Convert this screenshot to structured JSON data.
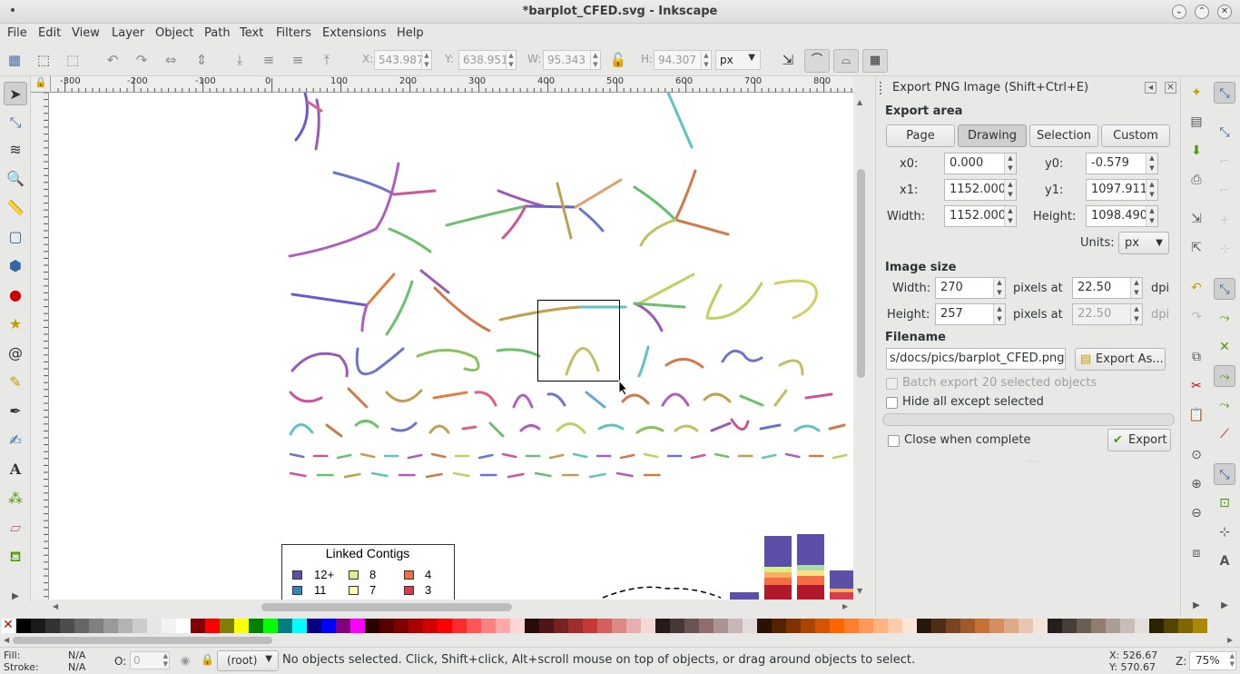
{
  "window": {
    "title": "*barplot_CFED.svg - Inkscape"
  },
  "menu": [
    "File",
    "Edit",
    "View",
    "Layer",
    "Object",
    "Path",
    "Text",
    "Filters",
    "Extensions",
    "Help"
  ],
  "toolbar": {
    "x_label": "X:",
    "x_value": "543.987",
    "y_label": "Y:",
    "y_value": "638.951",
    "w_label": "W:",
    "w_value": "95.343",
    "h_label": "H:",
    "h_value": "94.307",
    "unit": "px"
  },
  "ruler": {
    "h_ticks": [
      "-300",
      "-200",
      "-100",
      "0",
      "100",
      "200",
      "300",
      "400",
      "500",
      "600",
      "700",
      "800"
    ]
  },
  "canvas": {
    "legend_title": "Linked Contigs",
    "legend_items": [
      {
        "label": "12+",
        "color": "#5b4fa8"
      },
      {
        "label": "8",
        "color": "#d9ef8b"
      },
      {
        "label": "4",
        "color": "#f46d43"
      },
      {
        "label": "11",
        "color": "#3288bd"
      },
      {
        "label": "7",
        "color": "#fefeb2"
      },
      {
        "label": "3",
        "color": "#d53e4f"
      }
    ]
  },
  "dialog": {
    "title": "Export PNG Image (Shift+Ctrl+E)",
    "export_area_label": "Export area",
    "area_buttons": [
      "Page",
      "Drawing",
      "Selection",
      "Custom"
    ],
    "active_area": "Drawing",
    "x0_label": "x0:",
    "x0": "0.000",
    "y0_label": "y0:",
    "y0": "-0.579",
    "x1_label": "x1:",
    "x1": "1152.000",
    "y1_label": "y1:",
    "y1": "1097.911",
    "width_label": "Width:",
    "width": "1152.000",
    "height_label": "Height:",
    "height": "1098.490",
    "units_label": "Units:",
    "units": "px",
    "image_size_label": "Image size",
    "img_width_label": "Width:",
    "img_width": "270",
    "img_height_label": "Height:",
    "img_height": "257",
    "pixels_at": "pixels at",
    "dpi_value": "22.50",
    "dpi_value2": "22.50",
    "dpi": "dpi",
    "filename_label": "Filename",
    "filename": "s/docs/pics/barplot_CFED.png",
    "export_as": "Export As...",
    "batch_export": "Batch export 20 selected objects",
    "hide_all": "Hide all except selected",
    "close_when_complete": "Close when complete",
    "export": "Export"
  },
  "status": {
    "fill_label": "Fill:",
    "fill_value": "N/A",
    "stroke_label": "Stroke:",
    "stroke_value": "N/A",
    "opacity_label": "O:",
    "opacity_value": "0",
    "layer": "(root)",
    "message": "No objects selected. Click, Shift+click, Alt+scroll mouse on top of objects, or drag around objects to select.",
    "x_coord": "X: 526.67",
    "y_coord": "Y: 570.67",
    "zoom_label": "Z:",
    "zoom": "75%"
  },
  "palette_colors": [
    "#000000",
    "#1a1a1a",
    "#333333",
    "#4d4d4d",
    "#666666",
    "#808080",
    "#999999",
    "#b3b3b3",
    "#cccccc",
    "#e6e6e6",
    "#f2f2f2",
    "#ffffff",
    "#800000",
    "#ff0000",
    "#808000",
    "#ffff00",
    "#008000",
    "#00ff00",
    "#008080",
    "#00ffff",
    "#000080",
    "#0000ff",
    "#800080",
    "#ff00ff",
    "#2b0000",
    "#550000",
    "#800000",
    "#aa0000",
    "#d40000",
    "#ff0000",
    "#ff2a2a",
    "#ff5555",
    "#ff8080",
    "#ffaaaa",
    "#ffd5d5",
    "#280b0b",
    "#501616",
    "#782121",
    "#a02c2c",
    "#c83737",
    "#d35f5f",
    "#de8787",
    "#e9afaf",
    "#f4d7d7",
    "#241c1c",
    "#483737",
    "#6c5353",
    "#916f6f",
    "#ac9393",
    "#c8b7b7",
    "#e3dbdb",
    "#2b1100",
    "#552200",
    "#803300",
    "#aa4400",
    "#d45500",
    "#ff6600",
    "#ff7f2a",
    "#ff9955",
    "#ffb380",
    "#ffccaa",
    "#ffe6d5",
    "#28170b",
    "#502d16",
    "#784421",
    "#a05a2c",
    "#c87137",
    "#d38d5f",
    "#deaa87",
    "#e9c6af",
    "#f4e3d7",
    "#241f1c",
    "#483e37",
    "#6c5d53",
    "#917c6f",
    "#ac9d93",
    "#c8beb7",
    "#e3dedb",
    "#2b2200",
    "#554400",
    "#806600",
    "#aa8800"
  ]
}
